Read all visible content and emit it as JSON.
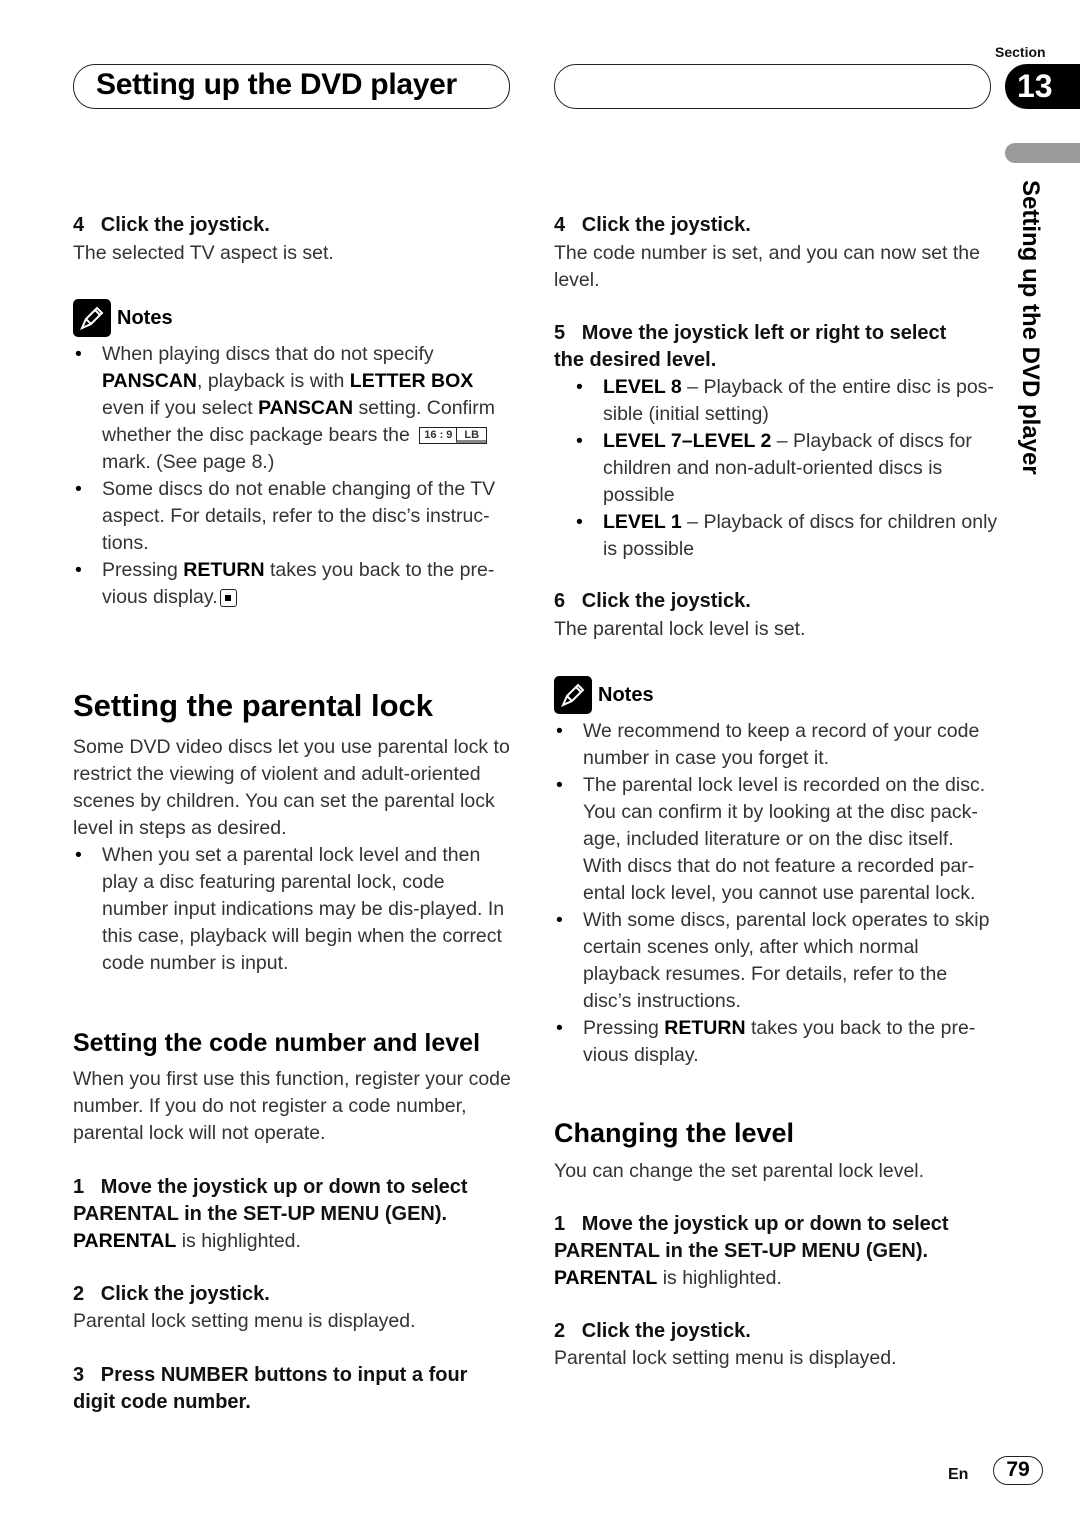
{
  "header": {
    "title": "Setting up the DVD player",
    "section_label": "Section",
    "section_number": "13",
    "side_tab_text": "Setting up the DVD player"
  },
  "left": {
    "step4": {
      "num": "4",
      "title": "Click the joystick.",
      "body": "The selected TV aspect is set."
    },
    "notes1": {
      "label": "Notes",
      "items": [
        {
          "parts": [
            "When playing discs that do not specify ",
            "PANSCAN",
            ", playback is with ",
            "LETTER BOX",
            " even if you select ",
            "PANSCAN",
            " setting. Confirm whether the disc package bears the ",
            " mark. (See page 8.)"
          ]
        },
        {
          "text": "Some discs do not enable changing of the TV aspect. For details, refer to the disc’s instruc-tions."
        },
        {
          "pre": "Pressing ",
          "bold": "RETURN",
          "post": " takes you back to the pre-vious display."
        }
      ],
      "aspect_mark": {
        "ratio": "16 : 9",
        "code": "LB"
      }
    },
    "parental_title": "Setting the parental lock",
    "parental_intro": "Some DVD video discs let you use parental lock to restrict the viewing of violent and adult-oriented scenes by children. You can set the parental lock level in steps as desired.",
    "parental_bullet": "When you set a parental lock level and then play a disc featuring parental lock, code number input indications may be dis-played. In this case, playback will begin when the correct code number is input.",
    "code_title": "Setting the code number and level",
    "code_intro": "When you first use this function, register your code number. If you do not register a code number, parental lock will not operate.",
    "steps": [
      {
        "num": "1",
        "title": "Move the joystick up or down to select",
        "title2": "PARENTAL in the SET-UP MENU (GEN).",
        "body_bold": "PARENTAL",
        "body": " is highlighted."
      },
      {
        "num": "2",
        "title": "Click the joystick.",
        "body": "Parental lock setting menu is displayed."
      },
      {
        "num": "3",
        "title": "Press NUMBER buttons to input a four",
        "title2": "digit code number."
      }
    ]
  },
  "right": {
    "step4": {
      "num": "4",
      "title": "Click the joystick.",
      "body": "The code number is set, and you can now set the level."
    },
    "step5": {
      "num": "5",
      "title": "Move the joystick left or right to select",
      "title2": "the desired level."
    },
    "levels": [
      {
        "name": "LEVEL 8",
        "desc": " – Playback of the entire disc is pos-sible (initial setting)"
      },
      {
        "name": "LEVEL 7–LEVEL 2",
        "desc": " – Playback of discs for children and non-adult-oriented discs is possible"
      },
      {
        "name": "LEVEL 1",
        "desc": " – Playback of discs for children only is possible"
      }
    ],
    "step6": {
      "num": "6",
      "title": "Click the joystick.",
      "body": "The parental lock level is set."
    },
    "notes2": {
      "label": "Notes",
      "items": [
        "We recommend to keep a record of your code number in case you forget it.",
        "The parental lock level is recorded on the disc. You can confirm it by looking at the disc pack-age, included literature or on the disc itself. With discs that do not feature a recorded par-ental lock level, you cannot use parental lock.",
        "With some discs, parental lock operates to skip certain scenes only, after which normal playback resumes. For details, refer to the disc’s instructions."
      ],
      "last": {
        "pre": "Pressing ",
        "bold": "RETURN",
        "post": " takes you back to the pre-vious display."
      }
    },
    "change_title": "Changing the level",
    "change_intro": "You can change the set parental lock level.",
    "steps": [
      {
        "num": "1",
        "title": "Move the joystick up or down to select",
        "title2": "PARENTAL in the SET-UP MENU (GEN).",
        "body_bold": "PARENTAL",
        "body": " is highlighted."
      },
      {
        "num": "2",
        "title": "Click the joystick.",
        "body": "Parental lock setting menu is displayed."
      }
    ]
  },
  "footer": {
    "lang": "En",
    "page": "79"
  }
}
